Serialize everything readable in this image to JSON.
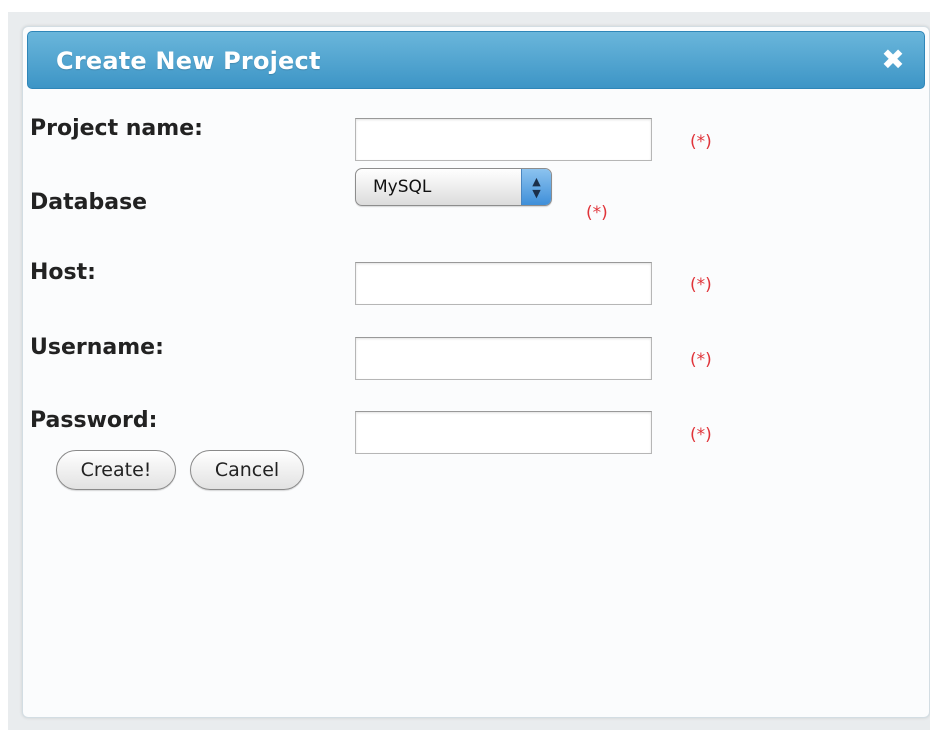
{
  "dialog": {
    "title": "Create New Project",
    "close_icon": "close-icon"
  },
  "form": {
    "required_marker": "(*)",
    "project_name": {
      "label": "Project name:",
      "value": ""
    },
    "database": {
      "label": "Database",
      "selected": "MySQL",
      "arrow_icon": "updown-arrows-icon"
    },
    "host": {
      "label": "Host:",
      "value": ""
    },
    "username": {
      "label": "Username:",
      "value": ""
    },
    "password": {
      "label": "Password:",
      "value": ""
    }
  },
  "buttons": {
    "create": "Create!",
    "cancel": "Cancel"
  },
  "colors": {
    "titlebar": "#3d95c6",
    "required": "#e0343a"
  }
}
